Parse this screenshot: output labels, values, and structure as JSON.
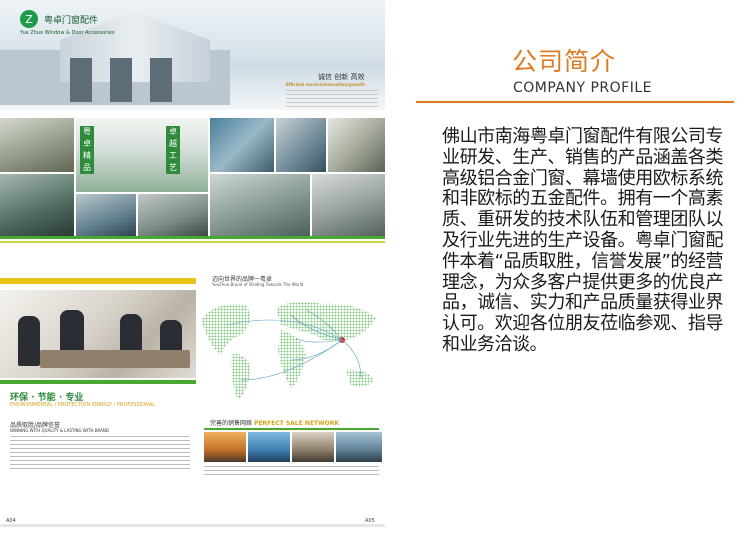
{
  "brochure": {
    "brand_name": "粤卓门窗配件",
    "brand_sub": "Yue Zhuo Window & Door Accessories",
    "logo_glyph": "Z",
    "slogan_cn": "诚信 创新 高效",
    "slogan_en": "Efficient service/innovation/growth",
    "panel_text": [
      "粤",
      "卓",
      "精",
      "品"
    ],
    "panel_text_right": [
      "卓",
      "越",
      "工",
      "艺"
    ],
    "eco_title": "环保 · 节能 · 专业",
    "eco_subtitle": "ENVIRONMENTAL / PROTECTION ENERGY / PROFESSIONAL",
    "eco_brand_cn": "品质取胜/品牌信誉",
    "eco_brand_en": "WINNING WITH QUALITY & LASTING WITH BRAND",
    "map_heading_cn": "迈向世界的品牌一粤卓",
    "map_heading_en": "YueZhuo Brand of Striding Towards The World",
    "network_cn": "完善的销售网络",
    "network_en": "PERFECT SALE NETWORK",
    "page_left": "A04",
    "page_right": "A05"
  },
  "profile": {
    "title_cn": "公司简介",
    "title_en": "COMPANY PROFILE",
    "body": "佛山市南海粤卓门窗配件有限公司专业研发、生产、销售的产品涵盖各类高级铝合金门窗、幕墙使用欧标系统和非欧标的五金配件。拥有一个高素质、重研发的技术队伍和管理团队以及行业先进的生产设备。粤卓门窗配件本着“品质取胜，信誉发展”的经营理念，为众多客户提供更多的优良产品，诚信、实力和产品质量获得业界认可。欢迎各位朋友莅临参观、指导和业务洽谈。"
  },
  "colors": {
    "accent_orange": "#e07a21",
    "brand_green": "#49a832",
    "brand_yellow": "#e8c41a"
  }
}
